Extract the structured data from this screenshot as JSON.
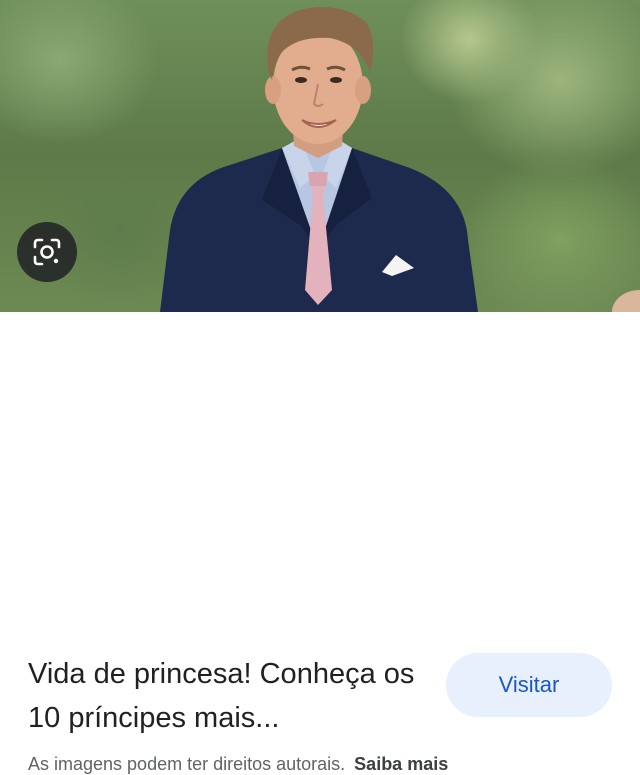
{
  "image": {
    "description_icon": "google-lens-icon"
  },
  "result": {
    "title": "Vida de princesa! Conheça os 10 príncipes mais...",
    "visit_label": "Visitar"
  },
  "footer": {
    "notice": "As imagens podem ter direitos autorais.",
    "learn_more": "Saiba mais"
  },
  "colors": {
    "accent": "#1a56c9",
    "button_bg": "#e8f0fe"
  }
}
